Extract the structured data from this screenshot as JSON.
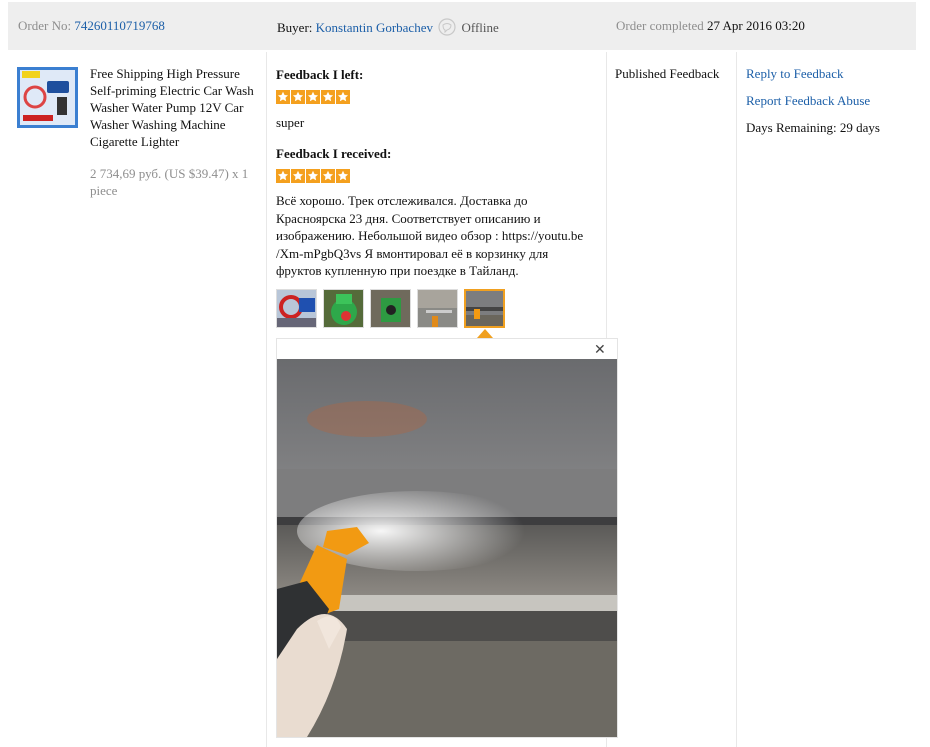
{
  "header": {
    "order_label": "Order No:",
    "order_number": "74260110719768",
    "buyer_label": "Buyer:",
    "buyer_name": "Konstantin Gorbachev",
    "buyer_status": "Offline",
    "completed_label": "Order completed",
    "completed_date": "27 Apr 2016 03:20"
  },
  "product": {
    "title": "Free Shipping High Pressure Self-priming Electric Car Wash Washer Water Pump 12V Car Washer Washing Machine Cigarette Lighter",
    "price": "2 734,69 руб. (US $39.47) x 1 piece"
  },
  "feedback": {
    "left_label": "Feedback I left:",
    "left_stars": 5,
    "left_comment": "super",
    "received_label": "Feedback I received:",
    "received_stars": 5,
    "received_comment": "Всё хорошо. Трек отслеживался. Доставка до Красноярска 23 дня. Соответствует описанию и изображению. Небольшой видео обзор : https://youtu.be /Xm-mPgbQ3vs Я вмонтировал её в корзинку для фруктов купленную при поездке в Тайланд.",
    "photo_count": 5,
    "active_photo": 5
  },
  "status": {
    "text": "Published Feedback"
  },
  "actions": {
    "reply": "Reply to Feedback",
    "report": "Report Feedback Abuse",
    "days_remaining": "Days Remaining: 29 days"
  },
  "colors": {
    "star": "#f4a01e",
    "link": "#1c5fa8",
    "active_thumb_border": "#f0a020"
  }
}
